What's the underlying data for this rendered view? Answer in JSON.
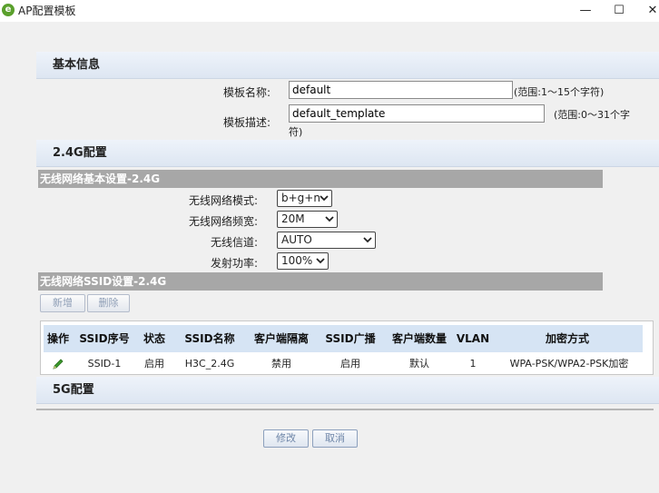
{
  "window": {
    "title": "AP配置模板",
    "minimize": "—",
    "maximize": "☐",
    "close": "✕"
  },
  "basic": {
    "heading": "基本信息",
    "name_label": "模板名称:",
    "name_value": "default",
    "name_hint": "(范围:1～15个字符)",
    "desc_label": "模板描述:",
    "desc_value": "default_template",
    "desc_hint_line1": "(范围:0～31个字",
    "desc_hint_line2": "符)"
  },
  "band24": {
    "heading": "2.4G配置",
    "basic_bar": "无线网络基本设置-2.4G",
    "mode_label": "无线网络模式:",
    "mode_value": "b+g+n",
    "width_label": "无线网络频宽:",
    "width_value": "20M",
    "channel_label": "无线信道:",
    "channel_value": "AUTO",
    "power_label": "发射功率:",
    "power_value": "100%",
    "ssid_bar": "无线网络SSID设置-2.4G",
    "add_button": "新增",
    "delete_button": "删除",
    "table": {
      "headers": [
        "操作",
        "SSID序号",
        "状态",
        "SSID名称",
        "客户端隔离",
        "SSID广播",
        "客户端数量",
        "VLAN",
        "加密方式"
      ],
      "rows": [
        [
          "",
          "SSID-1",
          "启用",
          "H3C_2.4G",
          "禁用",
          "启用",
          "默认",
          "1",
          "WPA-PSK/WPA2-PSK加密"
        ]
      ]
    }
  },
  "band5": {
    "heading": "5G配置"
  },
  "footer": {
    "modify_button": "修改",
    "cancel_button": "取消"
  }
}
